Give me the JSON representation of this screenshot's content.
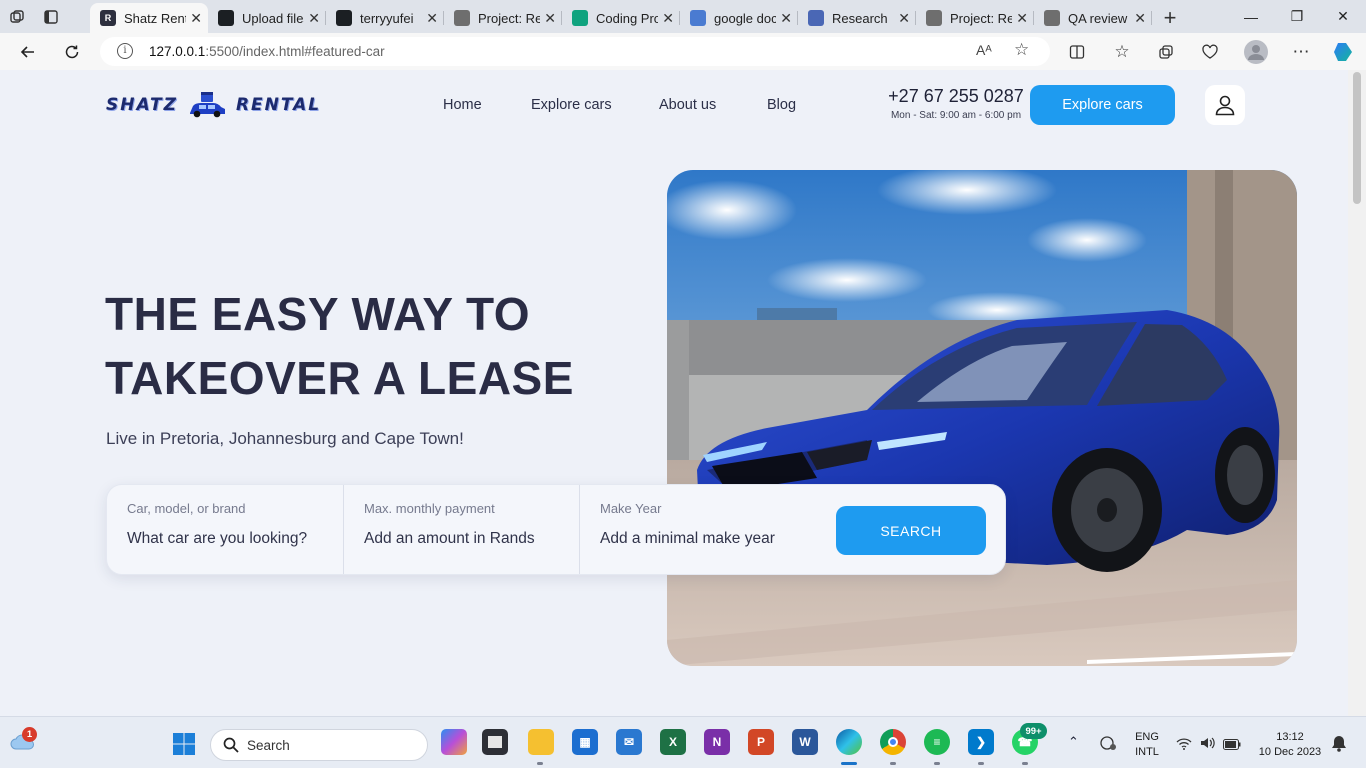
{
  "browser": {
    "tabs": [
      {
        "label": "Shatz Rental",
        "favicon": "R",
        "color": "#2d2f3e",
        "active": true
      },
      {
        "label": "Upload files",
        "favicon": "github-icon",
        "color": "#1b1f23"
      },
      {
        "label": "terryyufei",
        "favicon": "github-icon",
        "color": "#1b1f23"
      },
      {
        "label": "Project: Rental",
        "favicon": "alx-icon",
        "color": "#6e6e6e"
      },
      {
        "label": "Coding Project",
        "favicon": "chatgpt-icon",
        "color": "#10a37f"
      },
      {
        "label": "google docs",
        "favicon": "search-icon",
        "color": "#4a7bd1"
      },
      {
        "label": "Research",
        "favicon": "docs-icon",
        "color": "#4a67b5"
      },
      {
        "label": "Project: Rental",
        "favicon": "alx-icon",
        "color": "#6e6e6e"
      },
      {
        "label": "QA review",
        "favicon": "alx-icon",
        "color": "#6e6e6e"
      }
    ],
    "url_host": "127.0.0.1",
    "url_path": ":5500/index.html#featured-car"
  },
  "site": {
    "logo_left": "SHATZ",
    "logo_right": "RENTAL",
    "nav": [
      "Home",
      "Explore cars",
      "About us",
      "Blog"
    ],
    "phone": "+27 67 255 0287",
    "hours": "Mon - Sat: 9:00 am - 6:00 pm",
    "cta_label": "Explore cars",
    "accent": "#1e9bf0"
  },
  "hero": {
    "title_line1": "THE EASY WAY TO",
    "title_line2": "TAKEOVER A LEASE",
    "subtitle": "Live in Pretoria, Johannesburg and Cape Town!"
  },
  "search": {
    "fields": [
      {
        "label": "Car, model, or brand",
        "placeholder": "What car are you looking?"
      },
      {
        "label": "Max. monthly payment",
        "placeholder": "Add an amount in Rands"
      },
      {
        "label": "Make Year",
        "placeholder": "Add a minimal make year"
      }
    ],
    "button": "SEARCH"
  },
  "taskbar": {
    "search_placeholder": "Search",
    "weather_badge": "1",
    "whatsapp_badge": "99+",
    "lang_line1": "ENG",
    "lang_line2": "INTL",
    "time": "13:12",
    "date": "10 Dec 2023"
  }
}
